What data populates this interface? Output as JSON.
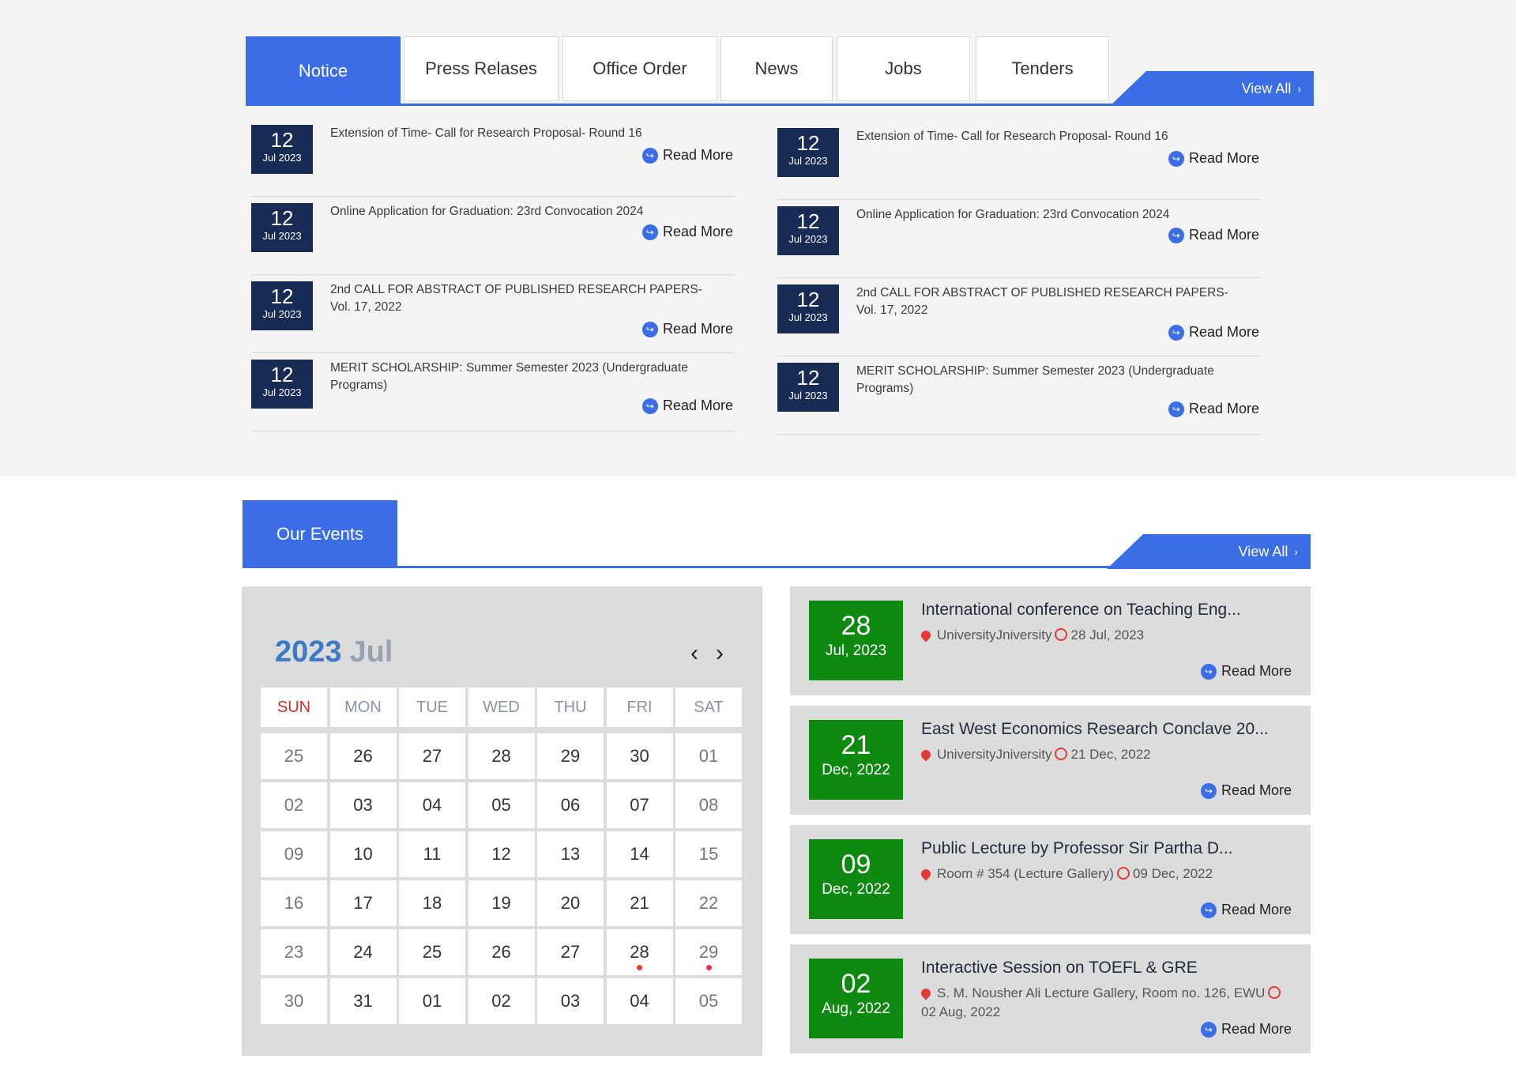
{
  "tabs": [
    "Notice",
    "Press Relases",
    "Office Order",
    "News",
    "Jobs",
    "Tenders"
  ],
  "active_tab": "Notice",
  "view_all": "View All",
  "read_more": "Read More",
  "notices_left": [
    {
      "day": "12",
      "mon": "Jul 2023",
      "title": "Extension of Time- Call for Research Proposal- Round 16"
    },
    {
      "day": "12",
      "mon": "Jul 2023",
      "title": "Online Application for Graduation: 23rd Convocation 2024"
    },
    {
      "day": "12",
      "mon": "Jul 2023",
      "title": "2nd CALL FOR ABSTRACT OF PUBLISHED RESEARCH PAPERS- Vol. 17, 2022"
    },
    {
      "day": "12",
      "mon": "Jul 2023",
      "title": "MERIT SCHOLARSHIP: Summer Semester 2023 (Undergraduate Programs)"
    }
  ],
  "notices_right": [
    {
      "day": "12",
      "mon": "Jul 2023",
      "title": "Extension of Time- Call for Research Proposal- Round 16"
    },
    {
      "day": "12",
      "mon": "Jul 2023",
      "title": "Online Application for Graduation: 23rd Convocation 2024"
    },
    {
      "day": "12",
      "mon": "Jul 2023",
      "title": "2nd CALL FOR ABSTRACT OF PUBLISHED RESEARCH PAPERS- Vol. 17, 2022"
    },
    {
      "day": "12",
      "mon": "Jul 2023",
      "title": "MERIT SCHOLARSHIP: Summer Semester 2023 (Undergraduate Programs)"
    }
  ],
  "events_heading": "Our Events",
  "calendar": {
    "year": "2023",
    "month": "Jul",
    "weekdays": [
      "SUN",
      "MON",
      "TUE",
      "WED",
      "THU",
      "FRI",
      "SAT"
    ],
    "weeks": [
      [
        "25",
        "26",
        "27",
        "28",
        "29",
        "30",
        "01"
      ],
      [
        "02",
        "03",
        "04",
        "05",
        "06",
        "07",
        "08"
      ],
      [
        "09",
        "10",
        "11",
        "12",
        "13",
        "14",
        "15"
      ],
      [
        "16",
        "17",
        "18",
        "19",
        "20",
        "21",
        "22"
      ],
      [
        "23",
        "24",
        "25",
        "26",
        "27",
        "28",
        "29"
      ],
      [
        "30",
        "31",
        "01",
        "02",
        "03",
        "04",
        "05"
      ]
    ],
    "event_days": [
      "28",
      "29"
    ]
  },
  "events": [
    {
      "day": "28",
      "mon": "Jul, 2023",
      "title": "International conference on Teaching Eng...",
      "location": "UniversityJniversity",
      "date": "28 Jul, 2023"
    },
    {
      "day": "21",
      "mon": "Dec, 2022",
      "title": "East West Economics Research Conclave 20...",
      "location": "UniversityJniversity",
      "date": "21 Dec, 2022"
    },
    {
      "day": "09",
      "mon": "Dec, 2022",
      "title": "Public Lecture by Professor Sir Partha D...",
      "location": "Room # 354 (Lecture Gallery)",
      "date": "09 Dec, 2022"
    },
    {
      "day": "02",
      "mon": "Aug, 2022",
      "title": "Interactive Session on TOEFL & GRE",
      "location": "S. M. Nousher Ali Lecture Gallery, Room no. 126, EWU",
      "date": "02 Aug, 2022"
    }
  ],
  "colors": {
    "accent": "#3b6ee6",
    "notice_date_bg": "#172b55",
    "event_date_bg": "#0e8a10",
    "marker": "#e53935"
  }
}
